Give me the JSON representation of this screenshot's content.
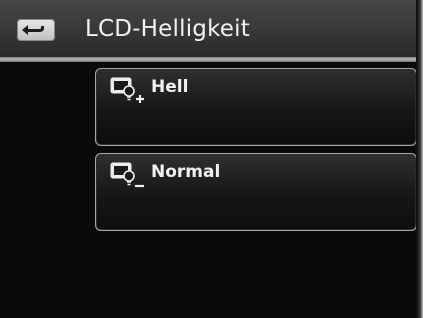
{
  "header": {
    "title": "LCD-Helligkeit",
    "back_icon": "back-arrow-icon"
  },
  "options": [
    {
      "label": "Hell",
      "icon": "lcd-brightness-plus-icon"
    },
    {
      "label": "Normal",
      "icon": "lcd-brightness-minus-icon"
    }
  ],
  "colors": {
    "background": "#0a0a0a",
    "titlebar": "#3a3a3a",
    "text": "#f2f2f2",
    "button_border": "#a8a8a8"
  }
}
